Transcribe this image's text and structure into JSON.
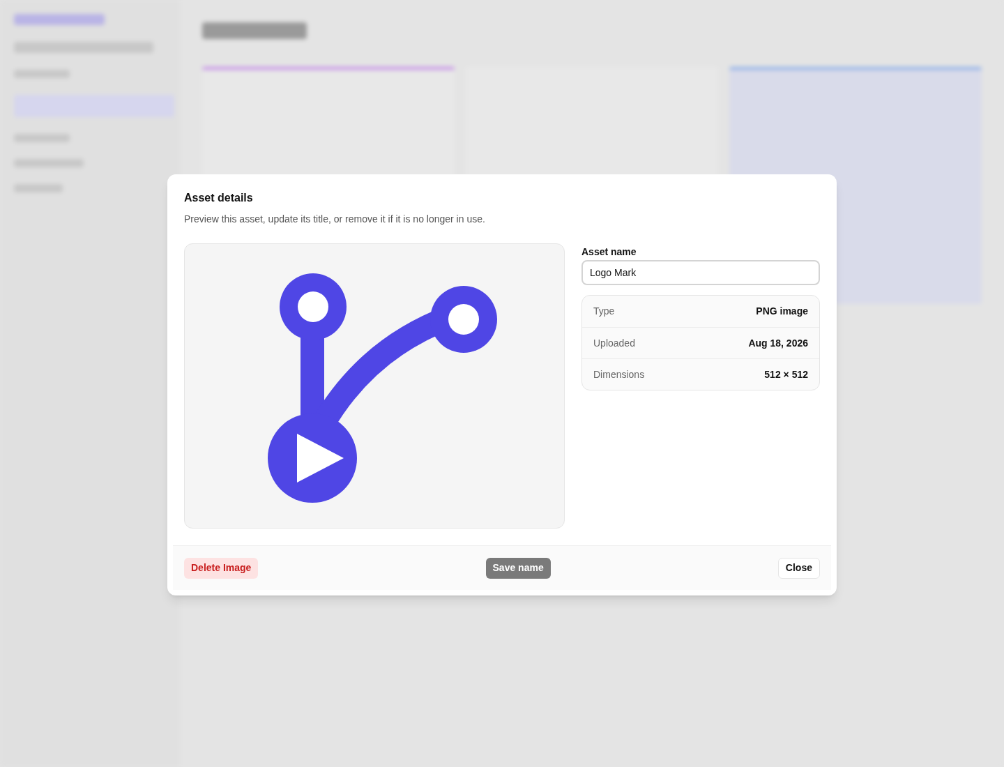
{
  "dialog": {
    "title": "Asset details",
    "description": "Preview this asset, update its title, or remove it if it is no longer in use.",
    "name_field": {
      "label": "Asset name",
      "value": "Logo Mark"
    },
    "details": [
      {
        "label": "Type",
        "value": "PNG image"
      },
      {
        "label": "Uploaded",
        "value": "Aug 18, 2026"
      },
      {
        "label": "Dimensions",
        "value": "512 × 512"
      }
    ],
    "buttons": [
      {
        "kind": "danger",
        "label": "Delete Image",
        "disabled": false
      },
      {
        "kind": "primary",
        "label": "Save name",
        "disabled": true
      },
      {
        "kind": "outline",
        "label": "Close",
        "disabled": false
      }
    ]
  }
}
